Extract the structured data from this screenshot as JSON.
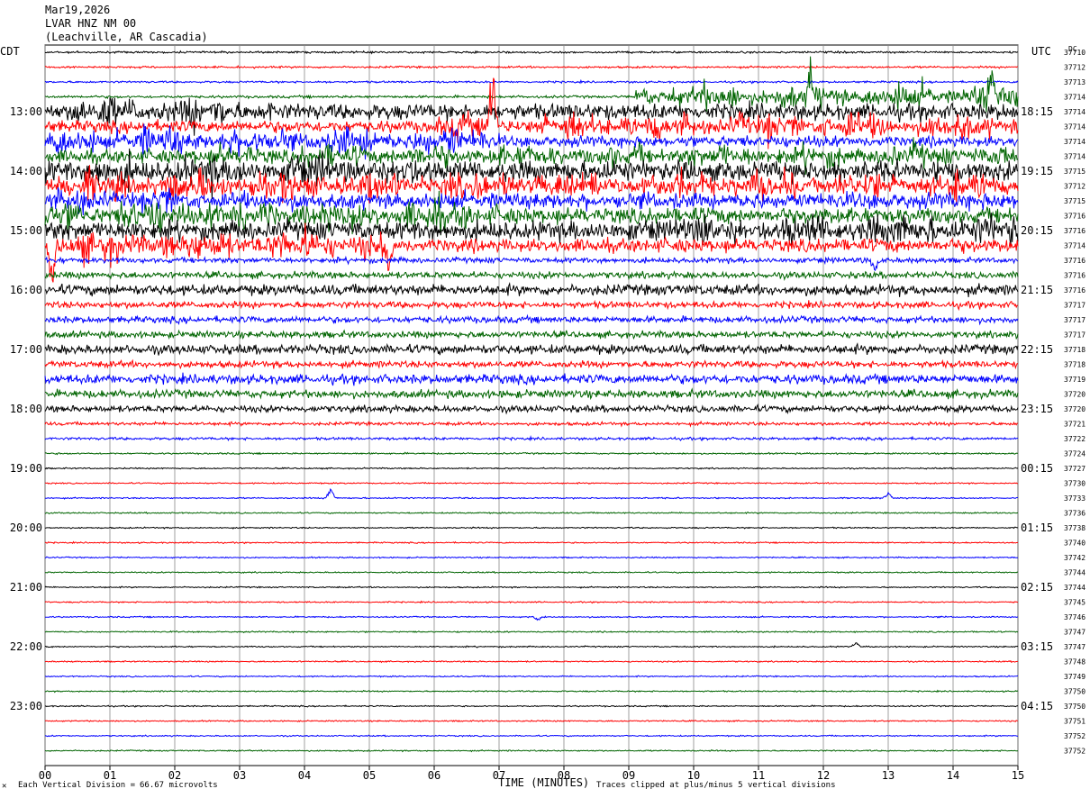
{
  "header": {
    "date": "Mar19,2026",
    "station": "LVAR HNZ NM 00",
    "location": "(Leachville, AR Cascadia)"
  },
  "left_tz": "CDT",
  "right_tz": "UTC",
  "dc_label": "DC",
  "footer": {
    "scale_prefix": "Each Vertical Division =",
    "scale_value": "66.67 microvolts",
    "xaxis_title": "TIME (MINUTES)",
    "clip_note": "Traces clipped at plus/minus 5 vertical divisions"
  },
  "colors": [
    "#000000",
    "#ff0000",
    "#0000ff",
    "#006400"
  ],
  "chart_data": {
    "type": "line",
    "title": "LVAR HNZ NM 00",
    "xlabel": "TIME (MINUTES)",
    "xlim": [
      0,
      15
    ],
    "x_ticks": [
      "00",
      "01",
      "02",
      "03",
      "04",
      "05",
      "06",
      "07",
      "08",
      "09",
      "10",
      "11",
      "12",
      "13",
      "14",
      "15"
    ],
    "left_hour_labels": [
      "13:00",
      "14:00",
      "15:00",
      "16:00",
      "17:00",
      "18:00",
      "19:00",
      "20:00",
      "21:00",
      "22:00",
      "23:00"
    ],
    "right_hour_labels": [
      "18:15",
      "19:15",
      "20:15",
      "21:15",
      "22:15",
      "23:15",
      "00:15",
      "01:15",
      "02:15",
      "03:15",
      "04:15"
    ],
    "dc_offsets": [
      "37710",
      "37712",
      "37713",
      "37714",
      "37714",
      "37714",
      "37714",
      "37714",
      "37715",
      "37712",
      "37715",
      "37716",
      "37716",
      "37714",
      "37716",
      "37716",
      "37716",
      "37717",
      "37717",
      "37717",
      "37718",
      "37718",
      "37719",
      "37720",
      "37720",
      "37721",
      "37722",
      "37724",
      "37727",
      "37730",
      "37733",
      "37736",
      "37738",
      "37740",
      "37742",
      "37744",
      "37744",
      "37745",
      "37746",
      "37747",
      "37747",
      "37748",
      "37749",
      "37750",
      "37750",
      "37751",
      "37752",
      "37752"
    ],
    "trace_noise": [
      1.5,
      1.5,
      1.5,
      2,
      12,
      9,
      8,
      10,
      15,
      10,
      12,
      12,
      14,
      10,
      4,
      5,
      8,
      5,
      5,
      5,
      7,
      5,
      7,
      6,
      5,
      2.5,
      2,
      1.2,
      1,
      1,
      1,
      1,
      1,
      1,
      1,
      1,
      1,
      1,
      1,
      1,
      1,
      1,
      1,
      1,
      1,
      1,
      1,
      1
    ],
    "bursts": [
      {
        "trace": 3,
        "x0": 9.1,
        "x1": 15,
        "amp": 25
      },
      {
        "trace": 4,
        "x0": 0,
        "x1": 3.5,
        "amp": 30
      },
      {
        "trace": 4,
        "x0": 4.5,
        "x1": 6,
        "amp": 10
      },
      {
        "trace": 5,
        "x0": 6,
        "x1": 15,
        "amp": 25
      },
      {
        "trace": 6,
        "x0": 0,
        "x1": 7,
        "amp": 28
      },
      {
        "trace": 7,
        "x0": 2,
        "x1": 15,
        "amp": 22
      },
      {
        "trace": 8,
        "x0": 0,
        "x1": 6,
        "amp": 30
      },
      {
        "trace": 9,
        "x0": 0,
        "x1": 15,
        "amp": 28
      },
      {
        "trace": 10,
        "x0": 0,
        "x1": 2,
        "amp": 22
      },
      {
        "trace": 11,
        "x0": 0,
        "x1": 7,
        "amp": 30
      },
      {
        "trace": 12,
        "x0": 9,
        "x1": 15,
        "amp": 30
      },
      {
        "trace": 13,
        "x0": 0,
        "x1": 5.3,
        "amp": 30
      },
      {
        "trace": 16,
        "x0": 0,
        "x1": 1,
        "amp": 10
      },
      {
        "trace": 16,
        "x0": 5.5,
        "x1": 6.5,
        "amp": 8
      }
    ],
    "spikes": [
      {
        "trace": 5,
        "x": 6.9,
        "amp": -60
      },
      {
        "trace": 3,
        "x": 11.8,
        "amp": -30
      },
      {
        "trace": 3,
        "x": 14.6,
        "amp": -30
      },
      {
        "trace": 13,
        "x": 0.1,
        "amp": 55
      },
      {
        "trace": 13,
        "x": 5.3,
        "amp": 40
      },
      {
        "trace": 14,
        "x": 12.8,
        "amp": 12
      },
      {
        "trace": 30,
        "x": 4.4,
        "amp": -10
      },
      {
        "trace": 30,
        "x": 13,
        "amp": -6
      },
      {
        "trace": 38,
        "x": 7.6,
        "amp": 4
      },
      {
        "trace": 40,
        "x": 12.5,
        "amp": -5
      }
    ]
  }
}
